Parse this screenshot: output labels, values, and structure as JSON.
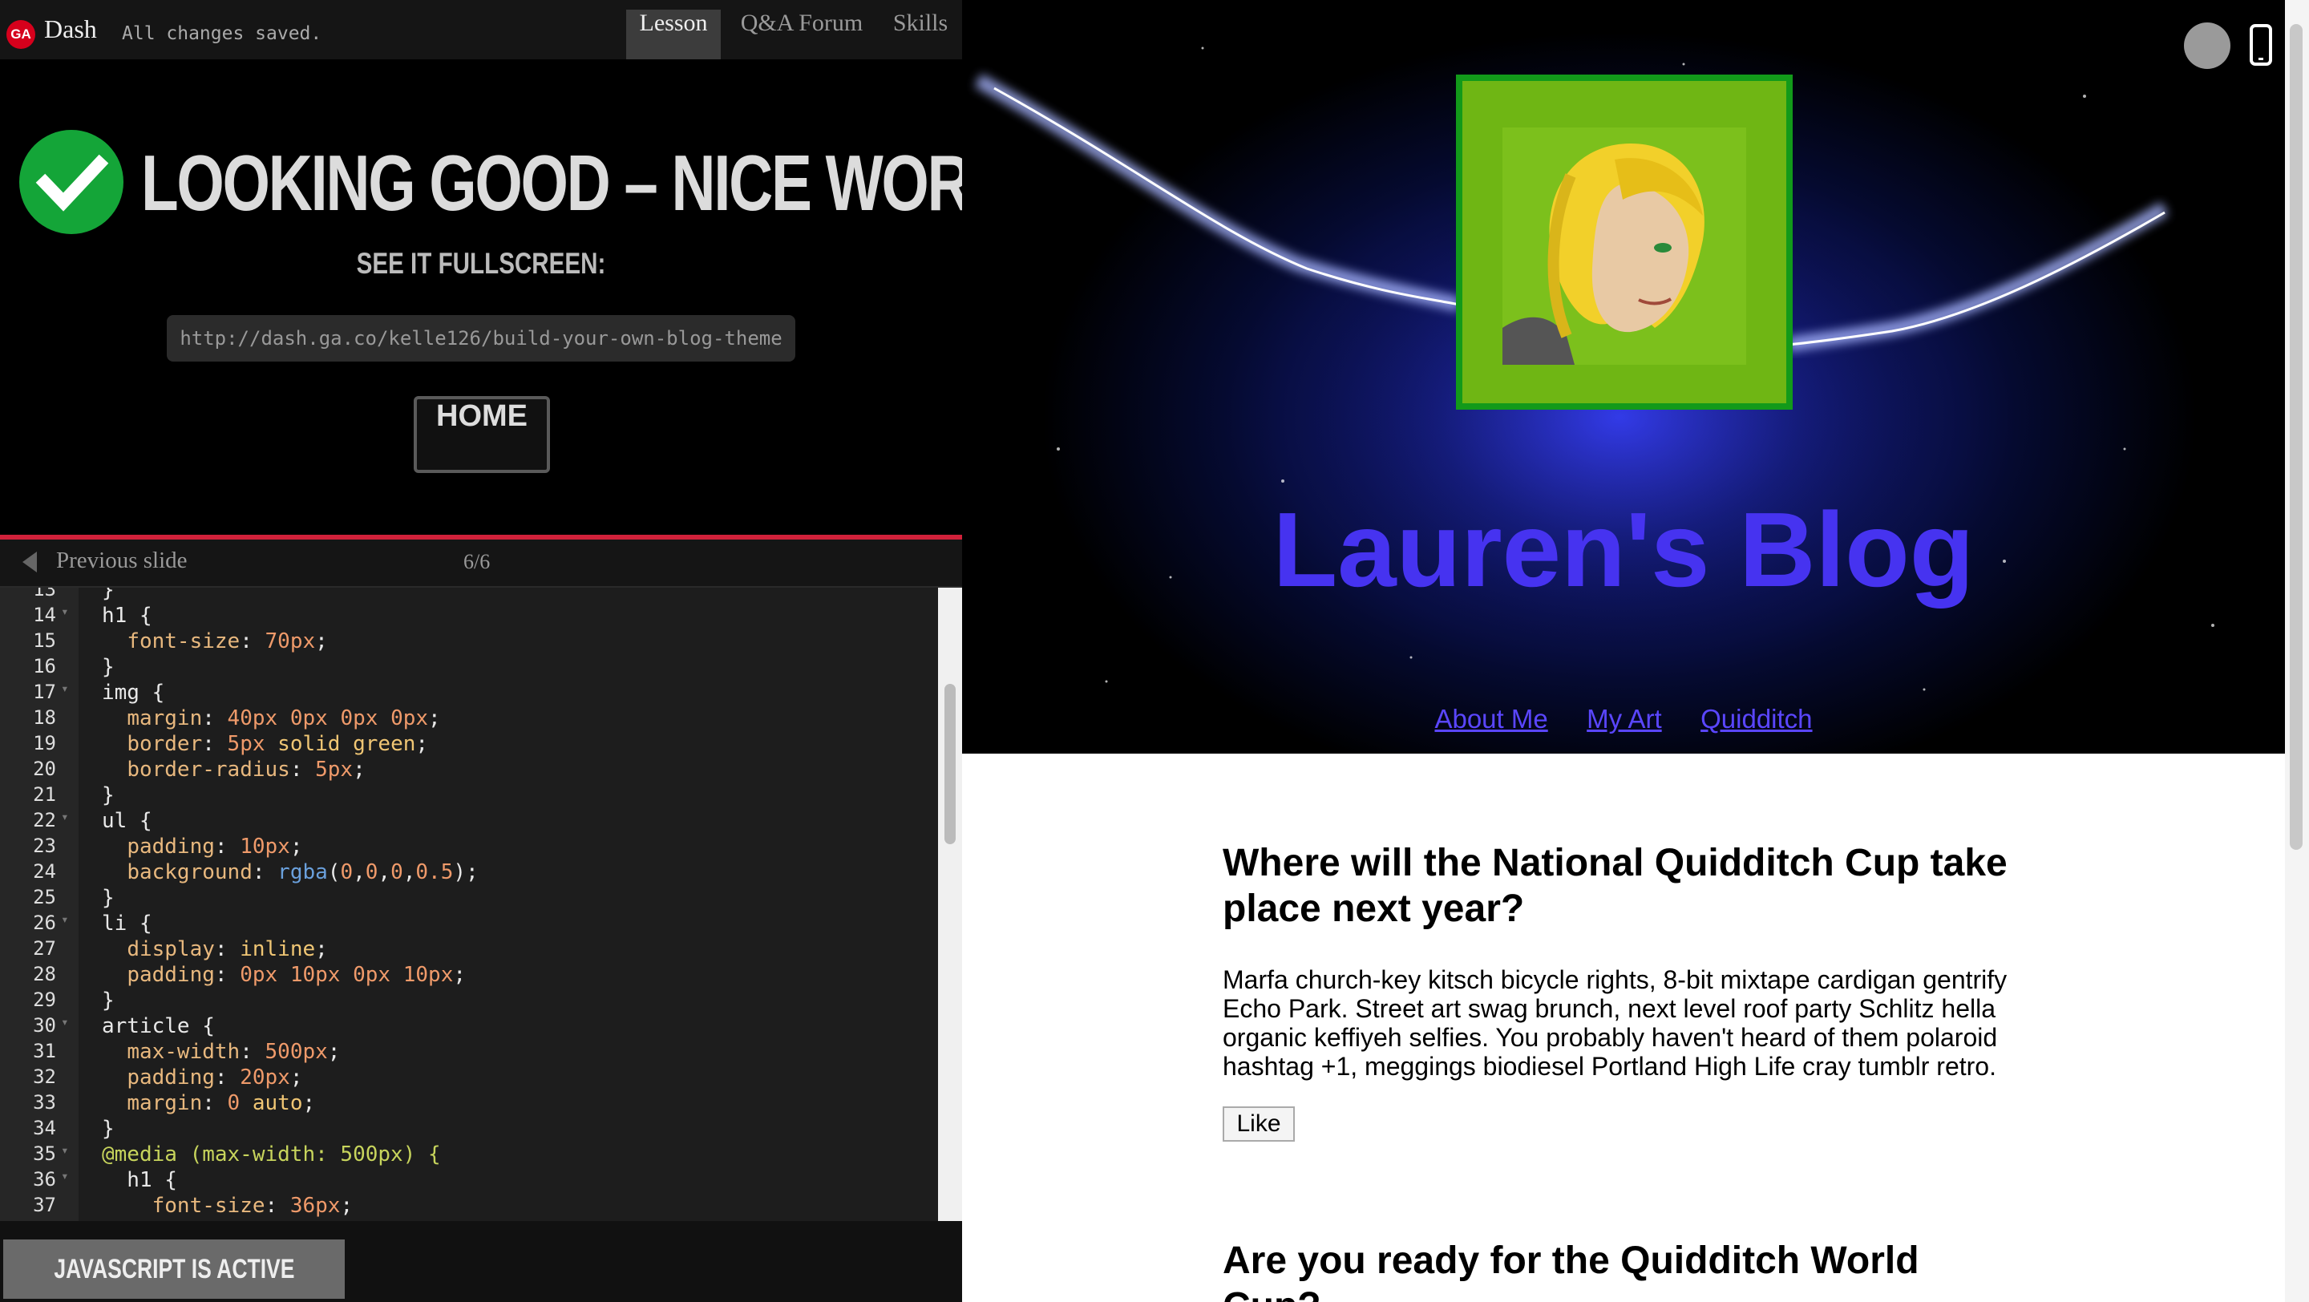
{
  "topbar": {
    "logo": "GA",
    "app_name": "Dash",
    "save_status": "All changes saved.",
    "tabs": [
      "Lesson",
      "Q&A Forum",
      "Skills"
    ]
  },
  "success": {
    "title": "LOOKING GOOD – NICE WORK!",
    "fullscreen_label": "SEE IT FULLSCREEN:",
    "url": "http://dash.ga.co/kelle126/build-your-own-blog-theme",
    "home_label": "HOME"
  },
  "slides": {
    "prev_label": "Previous slide",
    "count": "6/6"
  },
  "code": [
    {
      "n": "13",
      "t": "}"
    },
    {
      "n": "14",
      "t": "h1 {",
      "fold": true
    },
    {
      "n": "15",
      "t": "  font-size: 70px;"
    },
    {
      "n": "16",
      "t": "}"
    },
    {
      "n": "17",
      "t": "img {",
      "fold": true
    },
    {
      "n": "18",
      "t": "  margin: 40px 0px 0px 0px;"
    },
    {
      "n": "19",
      "t": "  border: 5px solid green;"
    },
    {
      "n": "20",
      "t": "  border-radius: 5px;"
    },
    {
      "n": "21",
      "t": "}"
    },
    {
      "n": "22",
      "t": "ul {",
      "fold": true
    },
    {
      "n": "23",
      "t": "  padding: 10px;"
    },
    {
      "n": "24",
      "t": "  background: rgba(0,0,0,0.5);"
    },
    {
      "n": "25",
      "t": "}"
    },
    {
      "n": "26",
      "t": "li {",
      "fold": true
    },
    {
      "n": "27",
      "t": "  display: inline;"
    },
    {
      "n": "28",
      "t": "  padding: 0px 10px 0px 10px;"
    },
    {
      "n": "29",
      "t": "}"
    },
    {
      "n": "30",
      "t": "article {",
      "fold": true
    },
    {
      "n": "31",
      "t": "  max-width: 500px;"
    },
    {
      "n": "32",
      "t": "  padding: 20px;"
    },
    {
      "n": "33",
      "t": "  margin: 0 auto;"
    },
    {
      "n": "34",
      "t": "}"
    },
    {
      "n": "35",
      "t": "@media (max-width: 500px) {",
      "fold": true
    },
    {
      "n": "36",
      "t": "  h1 {",
      "fold": true
    },
    {
      "n": "37",
      "t": "    font-size: 36px;"
    }
  ],
  "js_status": "JAVASCRIPT IS ACTIVE",
  "preview": {
    "blog_title": "Lauren's Blog",
    "nav": [
      "About Me",
      "My Art",
      "Quidditch"
    ],
    "articles": [
      {
        "heading": "Where will the National Quidditch Cup take place next year?",
        "body": "Marfa church-key kitsch bicycle rights, 8-bit mixtape cardigan gentrify Echo Park. Street art swag brunch, next level roof party Schlitz hella organic keffiyeh selfies. You probably haven't heard of them polaroid hashtag +1, meggings biodiesel Portland High Life cray tumblr retro.",
        "button": "Like"
      },
      {
        "heading": "Are you ready for the Quidditch World Cup?"
      }
    ]
  },
  "colors": {
    "accent_red": "#d0213a",
    "success_green": "#14a538",
    "blog_title": "#4633f0",
    "avatar_border": "#129a1a"
  },
  "icons": [
    "ga-logo-icon",
    "checkmark-icon",
    "chevron-left-icon",
    "circle-icon",
    "mobile-phone-icon"
  ]
}
